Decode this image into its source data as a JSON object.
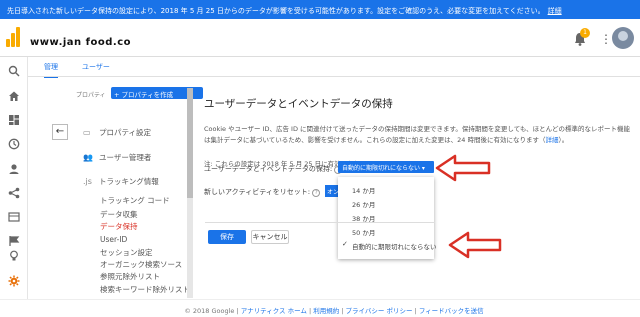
{
  "banner": {
    "text": "先日導入された新しいデータ保持の設定により、2018 年 5 月 25 日からのデータが影響を受ける可能性があります。設定をご確認のうえ、必要な変更を加えてください。",
    "link": "詳細",
    "color": "#1a73e8"
  },
  "header": {
    "account_small": "",
    "account_big": "www.jan food.co",
    "notification_count": "1"
  },
  "leftnav": {
    "icons": [
      "search-icon",
      "home-icon",
      "dashboard-icon",
      "clock-icon",
      "person-icon",
      "acquisition-icon",
      "behavior-icon",
      "flag-icon",
      "lightbulb-icon",
      "gear-icon",
      "expand-icon"
    ],
    "active_color": "#e8710a"
  },
  "tabs": [
    {
      "label": "管理"
    },
    {
      "label": "ユーザー"
    }
  ],
  "sidebar": {
    "property_label": "プロパティ",
    "create_button": "+ プロパティを作成",
    "items": [
      {
        "label": "プロパティ設定",
        "icon": "window-icon"
      },
      {
        "label": "ユーザー管理者",
        "icon": "users-icon"
      },
      {
        "label": "トラッキング情報",
        "icon": "js-icon"
      }
    ],
    "sub_items": [
      {
        "label": "トラッキング コード"
      },
      {
        "label": "データ収集"
      },
      {
        "label": "データ保持"
      },
      {
        "label": "User-ID"
      },
      {
        "label": "セッション設定"
      },
      {
        "label": "オーガニック検索ソース"
      },
      {
        "label": "参照元除外リスト"
      },
      {
        "label": "検索キーワード除外リスト"
      }
    ]
  },
  "main": {
    "title": "ユーザーデータとイベントデータの保持",
    "description": "Cookie やユーザー ID、広告 ID に関連付けて送ったデータの保持期間は変更できます。保持期間を変更しても、ほとんどの標準的なレポート機能は集計データに基づいているため、影響を受けません。これらの設定に加えた変更は、24 時間後に有効になります（",
    "description_link": "詳細",
    "description_end": "）。",
    "note": "注: これらの設定は 2018 年 5 月 25 日に有効になります",
    "retention_label": "ユーザーデータとイベントデータの保持:",
    "retention_value": "自動的に期限切れにならない ▾",
    "reset_label": "新しいアクティビティをリセット:",
    "reset_value": "オン",
    "dropdown": [
      {
        "label": "14 か月",
        "checked": false
      },
      {
        "label": "26 か月",
        "checked": false
      },
      {
        "label": "38 か月",
        "checked": false
      },
      {
        "label": "50 か月",
        "checked": false
      },
      {
        "label": "自動的に期限切れにならない",
        "checked": true
      }
    ],
    "save_label": "保存",
    "cancel_label": "キャンセル",
    "arrow_color": "#d93025"
  },
  "footer": {
    "copyright": "© 2018 Google | ",
    "links": [
      "アナリティクス ホーム",
      "利用規約",
      "プライバシー ポリシー",
      "フィードバックを送信"
    ]
  }
}
